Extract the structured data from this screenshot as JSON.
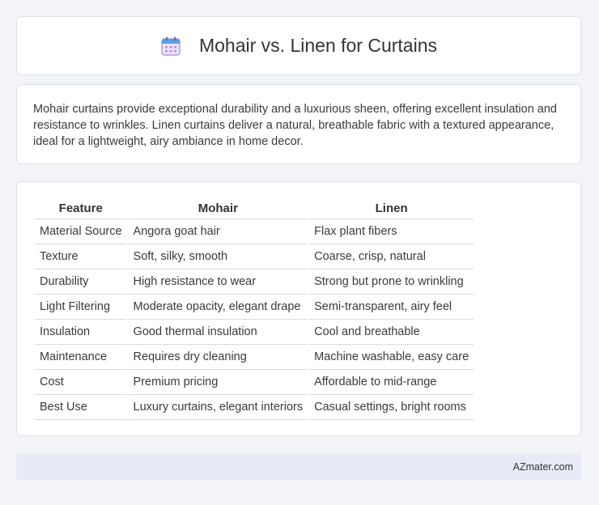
{
  "header": {
    "title": "Mohair vs. Linen for Curtains",
    "icon": "calendar-icon"
  },
  "description": "Mohair curtains provide exceptional durability and a luxurious sheen, offering excellent insulation and resistance to wrinkles. Linen curtains deliver a natural, breathable fabric with a textured appearance, ideal for a lightweight, airy ambiance in home decor.",
  "table": {
    "headers": [
      "Feature",
      "Mohair",
      "Linen"
    ],
    "rows": [
      [
        "Material Source",
        "Angora goat hair",
        "Flax plant fibers"
      ],
      [
        "Texture",
        "Soft, silky, smooth",
        "Coarse, crisp, natural"
      ],
      [
        "Durability",
        "High resistance to wear",
        "Strong but prone to wrinkling"
      ],
      [
        "Light Filtering",
        "Moderate opacity, elegant drape",
        "Semi-transparent, airy feel"
      ],
      [
        "Insulation",
        "Good thermal insulation",
        "Cool and breathable"
      ],
      [
        "Maintenance",
        "Requires dry cleaning",
        "Machine washable, easy care"
      ],
      [
        "Cost",
        "Premium pricing",
        "Affordable to mid-range"
      ],
      [
        "Best Use",
        "Luxury curtains, elegant interiors",
        "Casual settings, bright rooms"
      ]
    ]
  },
  "footer": {
    "brand": "AZmater.com"
  },
  "colors": {
    "page_background": "#f2f4f8",
    "card_background": "#ffffff",
    "footer_background": "#e6ebf5",
    "icon_accent": "#8f7ad6"
  }
}
